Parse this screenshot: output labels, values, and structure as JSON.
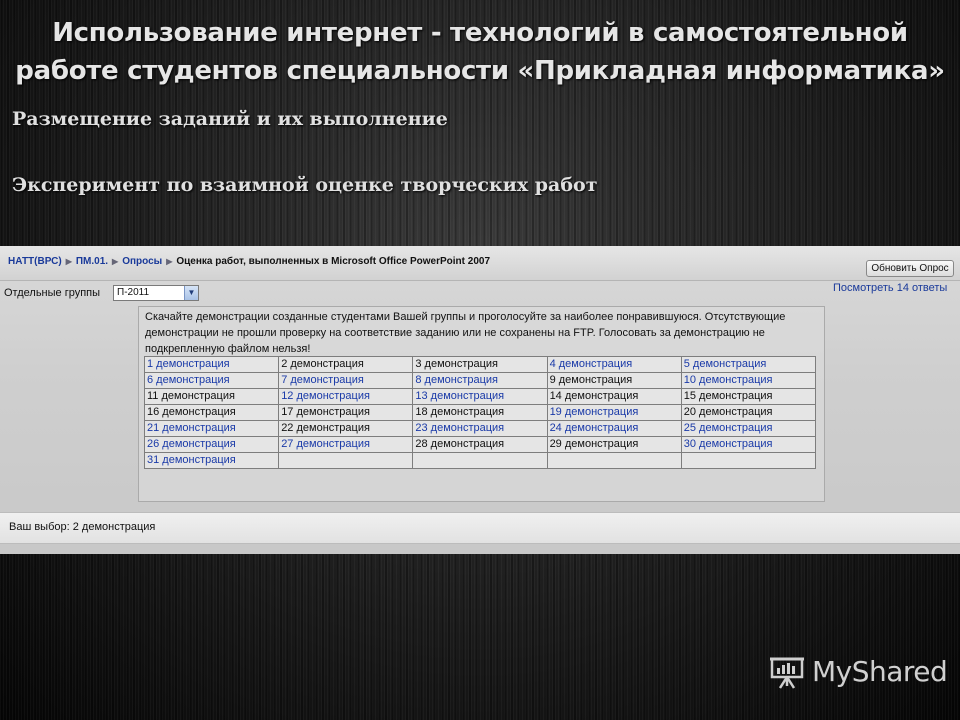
{
  "slide": {
    "title_line1": "Использование интернет - технологий в самостоятельной",
    "title_line2": "работе студентов специальности «Прикладная информатика»",
    "subtitle1": "Размещение заданий и их выполнение",
    "subtitle2": "Эксперимент по взаимной оценке творческих работ"
  },
  "breadcrumb": [
    {
      "label": "НАТТ(ВРС)",
      "link": true
    },
    {
      "label": "ПМ.01.",
      "link": true
    },
    {
      "label": "Опросы",
      "link": true
    },
    {
      "label": "Оценка работ, выполненных в Microsoft Office PowerPoint 2007",
      "link": false
    }
  ],
  "toolbar": {
    "update_button": "Обновить Опрос"
  },
  "groups": {
    "label": "Отдельные группы",
    "selected": "П-2011"
  },
  "view_answers_link": "Посмотреть 14 ответы",
  "question": {
    "text": "Скачайте демонстрации созданные студентами Вашей группы и проголосуйте за наиболее понравившуюся. Отсутствующие демонстрации не прошли проверку на соответствие заданию или не сохранены на FTP. Голосовать за демонстрацию не подкрепленную файлом нельзя!"
  },
  "demo_table": {
    "rows": [
      [
        {
          "label": "1 демонстрация",
          "link": true
        },
        {
          "label": "2 демонстрация",
          "link": false
        },
        {
          "label": "3 демонстрация",
          "link": false
        },
        {
          "label": "4 демонстрация",
          "link": true
        },
        {
          "label": "5 демонстрация",
          "link": true
        }
      ],
      [
        {
          "label": "6 демонстрация",
          "link": true
        },
        {
          "label": "7 демонстрация",
          "link": true
        },
        {
          "label": "8 демонстрация",
          "link": true
        },
        {
          "label": "9 демонстрация",
          "link": false
        },
        {
          "label": "10 демонстрация",
          "link": true
        }
      ],
      [
        {
          "label": "11 демонстрация",
          "link": false
        },
        {
          "label": "12 демонстрация",
          "link": true
        },
        {
          "label": "13 демонстрация",
          "link": true
        },
        {
          "label": "14 демонстрация",
          "link": false
        },
        {
          "label": "15 демонстрация",
          "link": false
        }
      ],
      [
        {
          "label": "16 демонстрация",
          "link": false
        },
        {
          "label": "17 демонстрация",
          "link": false
        },
        {
          "label": "18 демонстрация",
          "link": false
        },
        {
          "label": "19 демонстрация",
          "link": true
        },
        {
          "label": "20 демонстрация",
          "link": false
        }
      ],
      [
        {
          "label": "21 демонстрация",
          "link": true
        },
        {
          "label": "22 демонстрация",
          "link": false
        },
        {
          "label": "23 демонстрация",
          "link": true
        },
        {
          "label": "24 демонстрация",
          "link": true
        },
        {
          "label": "25 демонстрация",
          "link": true
        }
      ],
      [
        {
          "label": "26 демонстрация",
          "link": true
        },
        {
          "label": "27 демонстрация",
          "link": true
        },
        {
          "label": "28 демонстрация",
          "link": false
        },
        {
          "label": "29 демонстрация",
          "link": false
        },
        {
          "label": "30 демонстрация",
          "link": true
        }
      ],
      [
        {
          "label": "31 демонстрация",
          "link": true
        },
        {
          "label": "",
          "link": false
        },
        {
          "label": "",
          "link": false
        },
        {
          "label": "",
          "link": false
        },
        {
          "label": "",
          "link": false
        }
      ]
    ]
  },
  "choice": {
    "text": "Ваш выбор: 2 демонстрация"
  },
  "logo": {
    "text": "MyShared",
    "icon": "presentation-board-icon"
  }
}
